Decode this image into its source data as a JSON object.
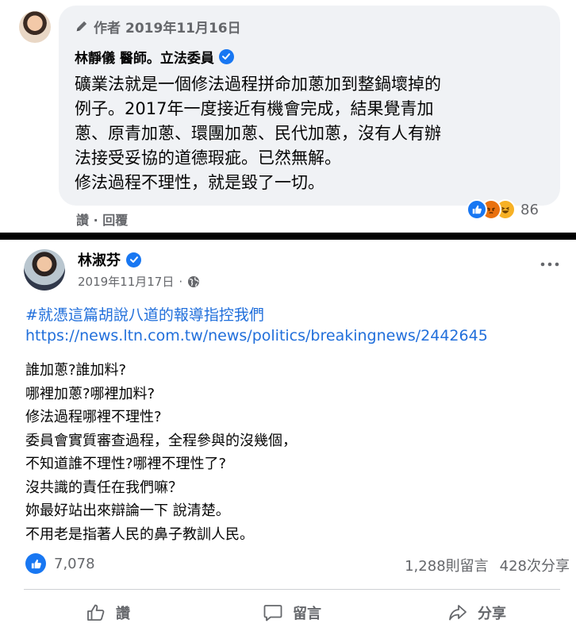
{
  "comment": {
    "edit_label": "作者",
    "date": "2019年11月16日",
    "author": "林靜儀 醫師。立法委員",
    "lines": [
      "礦業法就是一個修法過程拼命加蔥加到整鍋壞掉的",
      "例子。2017年一度接近有機會完成，結果覺青加",
      "蔥、原青加蔥、環團加蔥、民代加蔥，沒有人有辦",
      "法接受妥協的道德瑕疵。已然無解。",
      "修法過程不理性，就是毀了一切。"
    ],
    "like_label": "讚",
    "separator": " · ",
    "reply_label": "回覆",
    "reaction_count": "86",
    "reaction_icons": [
      "like-icon",
      "angry-icon",
      "haha-icon"
    ]
  },
  "post": {
    "author": "林淑芬",
    "date": "2019年11月17日",
    "date_separator": "·",
    "hashtag": "#就憑這篇胡說八道的報導指控我們",
    "link": "https://news.ltn.com.tw/news/politics/breakingnews/2442645",
    "lines": [
      "誰加蔥?誰加料?",
      "哪裡加蔥?哪裡加料?",
      "修法過程哪裡不理性?",
      "委員會實質審查過程，全程參與的沒幾個，",
      "不知道誰不理性?哪裡不理性了?",
      "沒共識的責任在我們嘛？",
      "妳最好站出來辯論一下 說清楚。",
      "不用老是指著人民的鼻子教訓人民。"
    ],
    "like_count": "7,078",
    "comment_count": "1,288則留言",
    "share_count": "428次分享",
    "actions": {
      "like": "讚",
      "comment": "留言",
      "share": "分享"
    }
  },
  "colors": {
    "link": "#216fdb",
    "brand_blue": "#1877f2",
    "muted": "#65676b",
    "bubble": "#f0f2f5"
  }
}
